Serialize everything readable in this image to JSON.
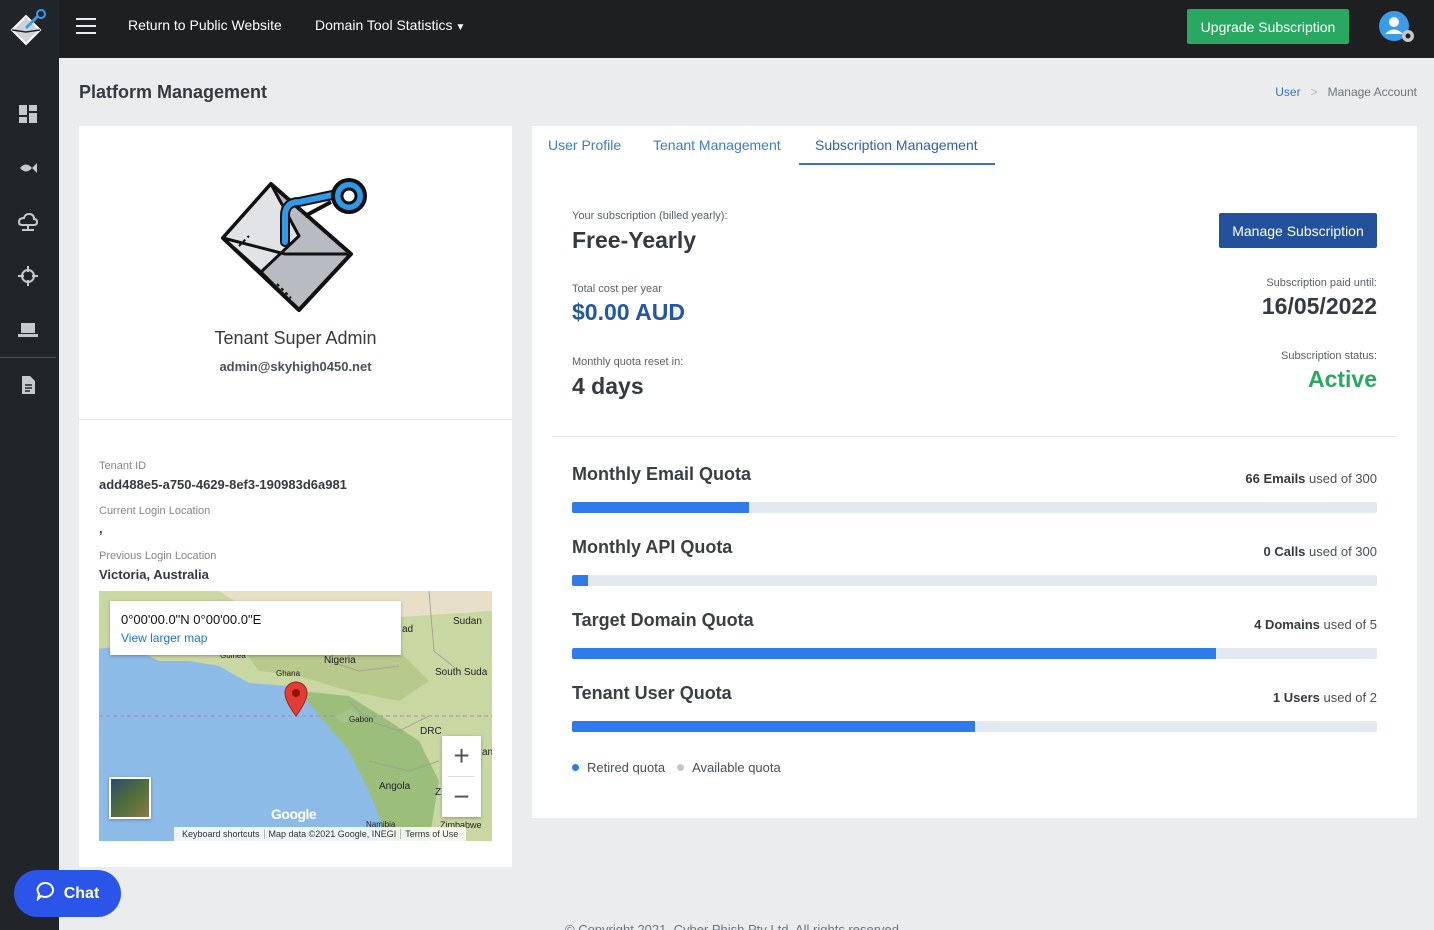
{
  "topbar": {
    "return_link": "Return to Public Website",
    "stats_menu": "Domain Tool Statistics",
    "upgrade_button": "Upgrade Subscription"
  },
  "sidebar": {
    "items": [
      {
        "icon": "dashboard-icon"
      },
      {
        "icon": "fish-icon"
      },
      {
        "icon": "cloud-network-icon"
      },
      {
        "icon": "crosshair-icon"
      },
      {
        "icon": "laptop-icon"
      },
      {
        "icon": "document-icon"
      }
    ]
  },
  "page": {
    "title": "Platform Management",
    "breadcrumb": [
      "User",
      "Manage Account"
    ]
  },
  "profile": {
    "name": "Tenant Super Admin",
    "email": "admin@skyhigh0450.net",
    "tenant_id_label": "Tenant ID",
    "tenant_id": "add488e5-a750-4629-8ef3-190983d6a981",
    "current_location_label": "Current Login Location",
    "current_location": ",",
    "previous_location_label": "Previous Login Location",
    "previous_location": "Victoria, Australia"
  },
  "map": {
    "coords": "0°00'00.0\"N 0°00'00.0\"E",
    "view_larger": "View larger map",
    "zoom_in": "+",
    "zoom_out": "−",
    "google": "Google",
    "footer": [
      "Keyboard shortcuts",
      "Map data ©2021 Google, INEGI",
      "Terms of Use"
    ],
    "labels": {
      "sudan": "Sudan",
      "ad": "ad",
      "guinea": "Guinea",
      "nigeria": "Nigeria",
      "ghana": "Ghana",
      "south_sudan": "South Suda",
      "gabon": "Gabon",
      "drc": "DRC",
      "an": "an",
      "angola": "Angola",
      "z": "Z",
      "namibia": "Namibia",
      "zimbabwe": "Zimbabwe"
    }
  },
  "tabs": [
    "User Profile",
    "Tenant Management",
    "Subscription Management"
  ],
  "subscription": {
    "plan_label": "Your subscription (billed yearly):",
    "plan": "Free-Yearly",
    "manage_button": "Manage Subscription",
    "cost_label": "Total cost per year",
    "cost": "$0.00 AUD",
    "paid_until_label": "Subscription paid until:",
    "paid_until": "16/05/2022",
    "reset_label": "Monthly quota reset in:",
    "reset": "4 days",
    "status_label": "Subscription status:",
    "status": "Active"
  },
  "quotas": [
    {
      "title": "Monthly Email Quota",
      "used_text": "66 Emails",
      "of_text": "used of 300",
      "used": 66,
      "total": 300
    },
    {
      "title": "Monthly API Quota",
      "used_text": "0 Calls",
      "of_text": "used of 300",
      "used": 0,
      "total": 300
    },
    {
      "title": "Target Domain Quota",
      "used_text": "4 Domains",
      "of_text": "used of 5",
      "used": 4,
      "total": 5
    },
    {
      "title": "Tenant User Quota",
      "used_text": "1 Users",
      "of_text": "used of 2",
      "used": 1,
      "total": 2
    }
  ],
  "legend": {
    "retired": "Retired quota",
    "available": "Available quota"
  },
  "footer": "© Copyright 2021. Cyber Phish Pty Ltd. All rights reserved.",
  "chat": "Chat",
  "colors": {
    "accent_blue": "#2f7bec",
    "status_green": "#28a860",
    "sidebar_bg": "#212529"
  }
}
